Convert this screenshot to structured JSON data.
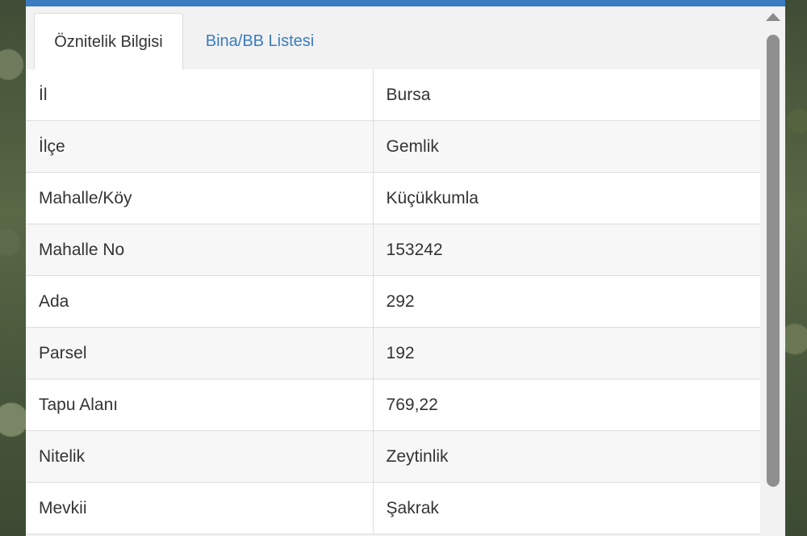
{
  "tabs": [
    {
      "label": "Öznitelik Bilgisi",
      "active": true
    },
    {
      "label": "Bina/BB Listesi",
      "active": false
    }
  ],
  "attributes": [
    {
      "key": "İl",
      "value": "Bursa"
    },
    {
      "key": "İlçe",
      "value": "Gemlik"
    },
    {
      "key": "Mahalle/Köy",
      "value": "Küçükkumla"
    },
    {
      "key": "Mahalle No",
      "value": "153242"
    },
    {
      "key": "Ada",
      "value": "292"
    },
    {
      "key": "Parsel",
      "value": "192"
    },
    {
      "key": "Tapu Alanı",
      "value": "769,22"
    },
    {
      "key": "Nitelik",
      "value": "Zeytinlik"
    },
    {
      "key": "Mevkii",
      "value": "Şakrak"
    }
  ],
  "colors": {
    "accent": "#3a7cbf",
    "panel_bg": "#f2f2f2",
    "text": "#333333"
  },
  "icons": {
    "scroll_up": "triangle-up-icon"
  }
}
